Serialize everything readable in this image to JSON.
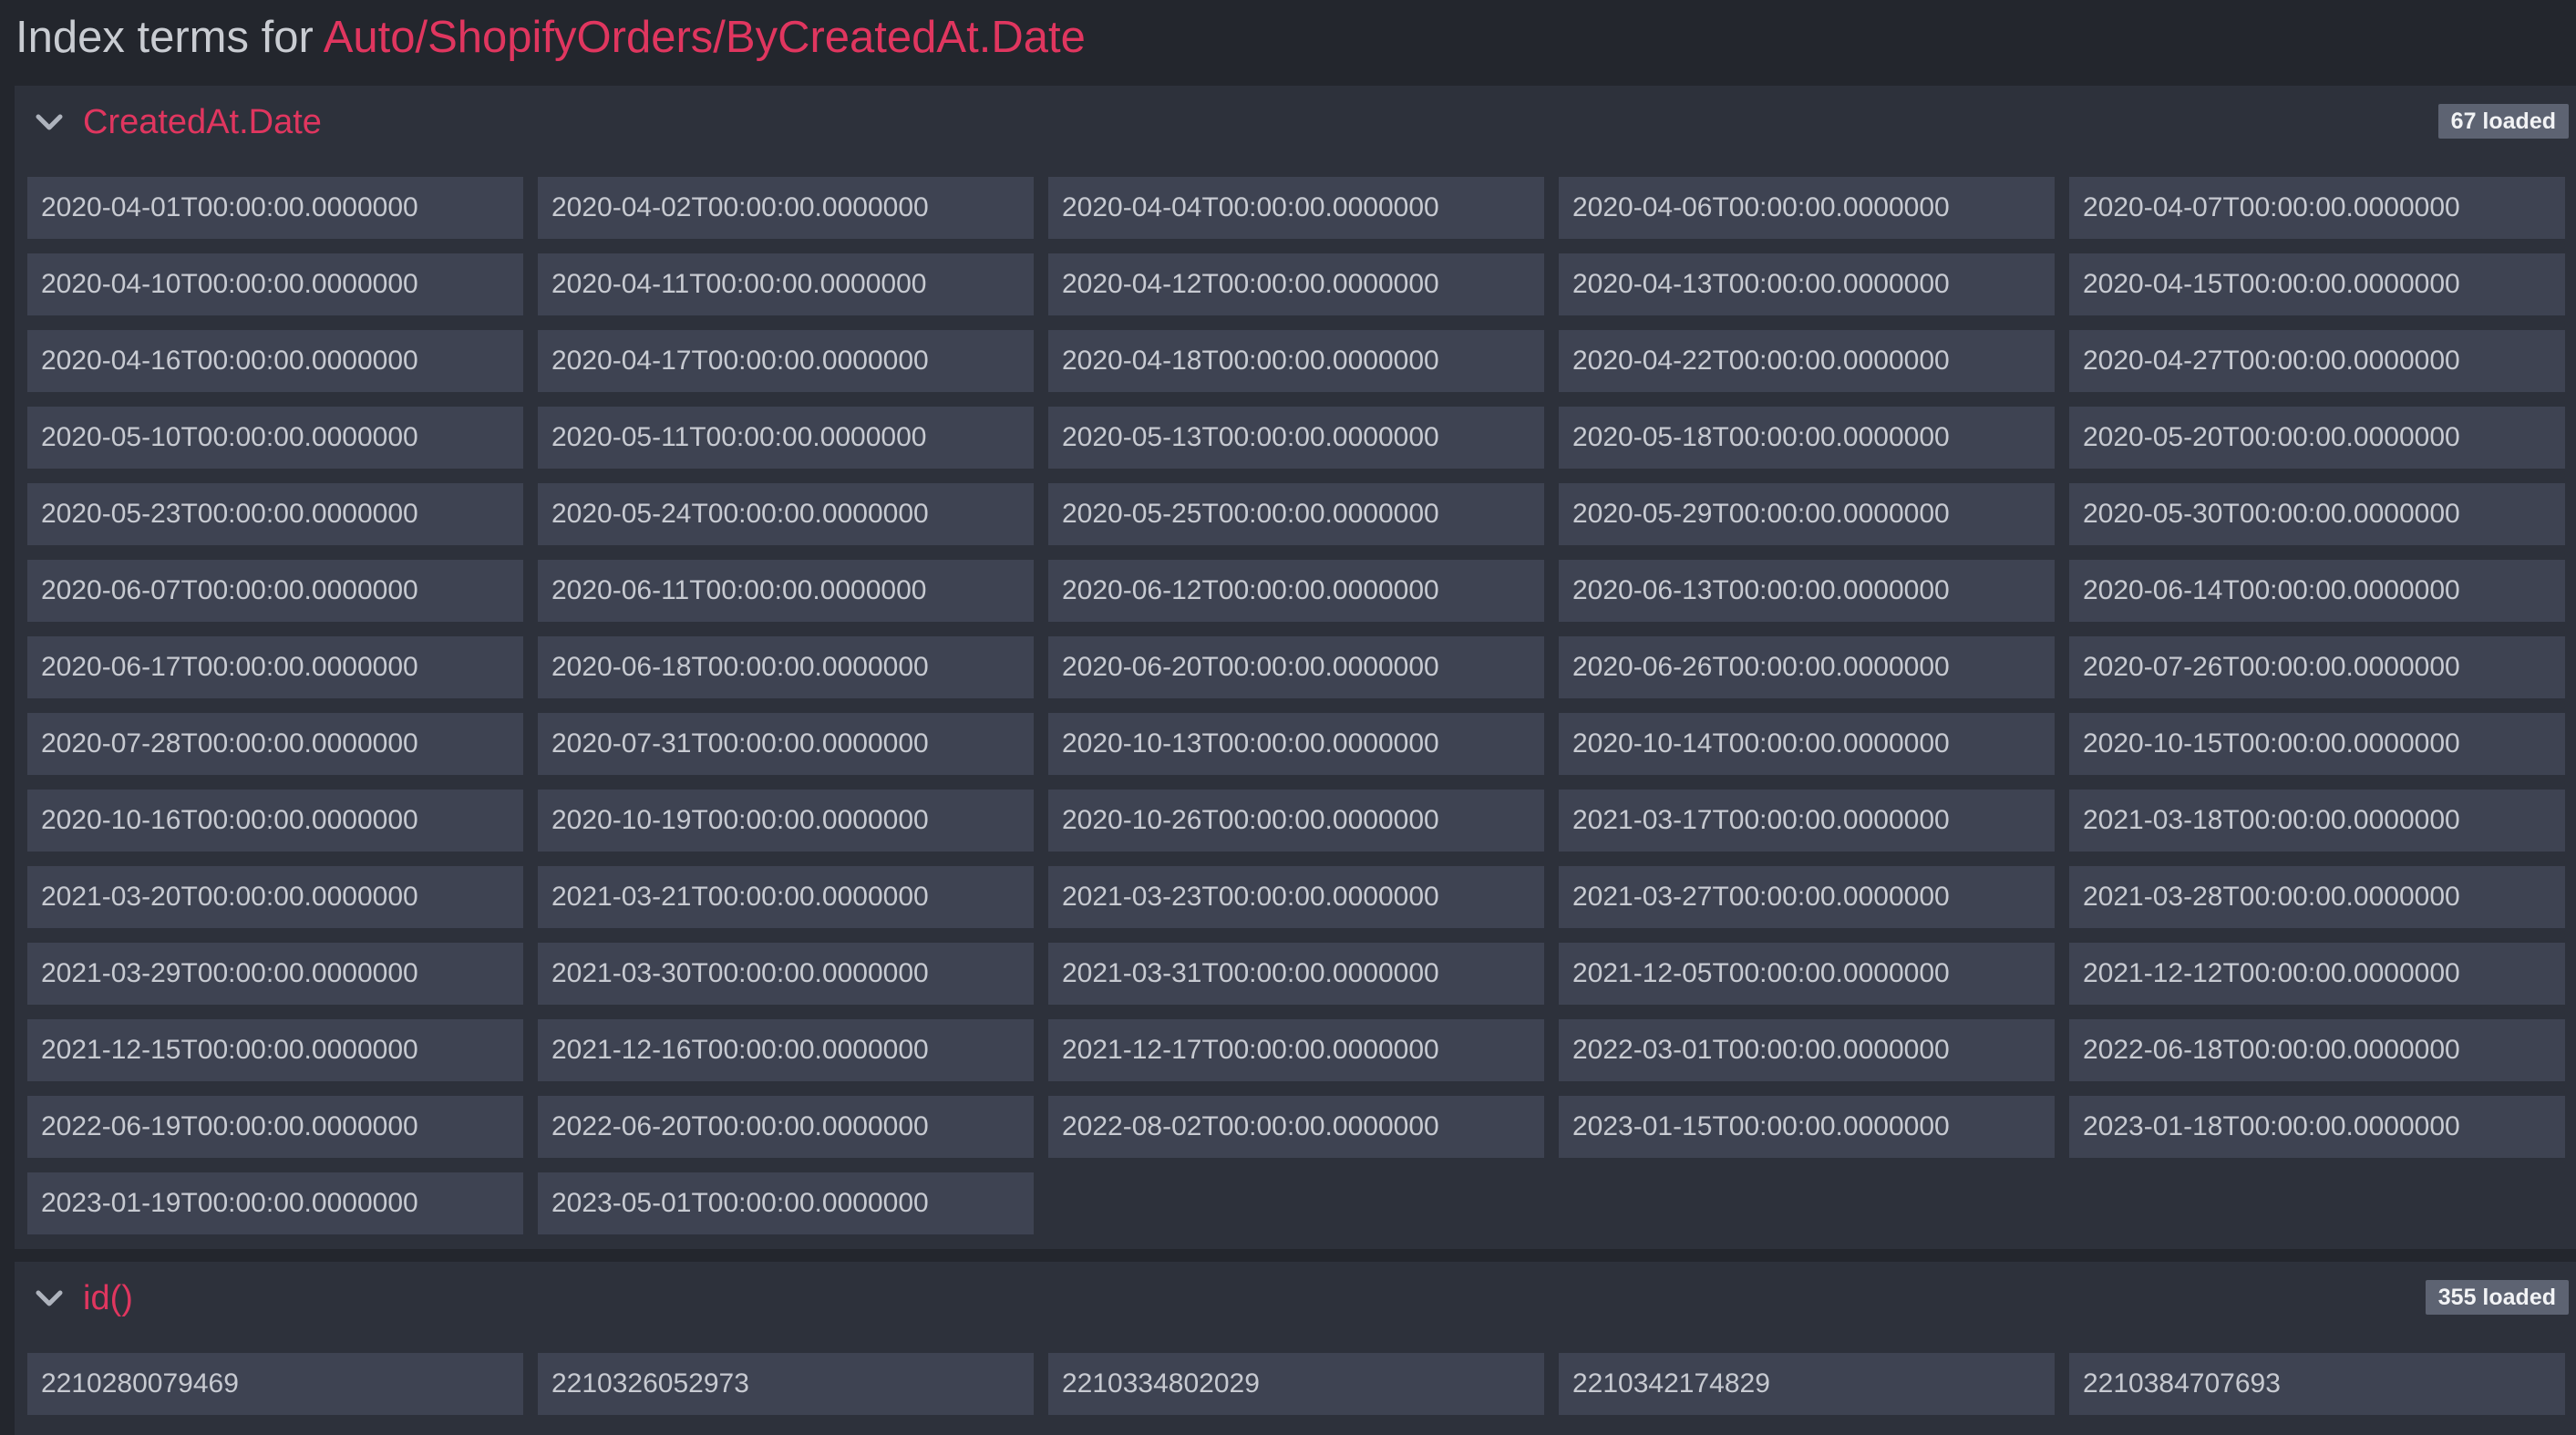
{
  "title": {
    "prefix": "Index terms for ",
    "path": "Auto/ShopifyOrders/ByCreatedAt.Date"
  },
  "icons": {
    "expand": "chevron-down-icon"
  },
  "colors": {
    "accent": "#e0365f",
    "background": "#23262d",
    "panel": "#2d313b",
    "term": "#3e4352",
    "badge": "#5d6372"
  },
  "sections": [
    {
      "field": "CreatedAt.Date",
      "loaded": "67 loaded",
      "terms": [
        "2020-04-01T00:00:00.0000000",
        "2020-04-02T00:00:00.0000000",
        "2020-04-04T00:00:00.0000000",
        "2020-04-06T00:00:00.0000000",
        "2020-04-07T00:00:00.0000000",
        "2020-04-10T00:00:00.0000000",
        "2020-04-11T00:00:00.0000000",
        "2020-04-12T00:00:00.0000000",
        "2020-04-13T00:00:00.0000000",
        "2020-04-15T00:00:00.0000000",
        "2020-04-16T00:00:00.0000000",
        "2020-04-17T00:00:00.0000000",
        "2020-04-18T00:00:00.0000000",
        "2020-04-22T00:00:00.0000000",
        "2020-04-27T00:00:00.0000000",
        "2020-05-10T00:00:00.0000000",
        "2020-05-11T00:00:00.0000000",
        "2020-05-13T00:00:00.0000000",
        "2020-05-18T00:00:00.0000000",
        "2020-05-20T00:00:00.0000000",
        "2020-05-23T00:00:00.0000000",
        "2020-05-24T00:00:00.0000000",
        "2020-05-25T00:00:00.0000000",
        "2020-05-29T00:00:00.0000000",
        "2020-05-30T00:00:00.0000000",
        "2020-06-07T00:00:00.0000000",
        "2020-06-11T00:00:00.0000000",
        "2020-06-12T00:00:00.0000000",
        "2020-06-13T00:00:00.0000000",
        "2020-06-14T00:00:00.0000000",
        "2020-06-17T00:00:00.0000000",
        "2020-06-18T00:00:00.0000000",
        "2020-06-20T00:00:00.0000000",
        "2020-06-26T00:00:00.0000000",
        "2020-07-26T00:00:00.0000000",
        "2020-07-28T00:00:00.0000000",
        "2020-07-31T00:00:00.0000000",
        "2020-10-13T00:00:00.0000000",
        "2020-10-14T00:00:00.0000000",
        "2020-10-15T00:00:00.0000000",
        "2020-10-16T00:00:00.0000000",
        "2020-10-19T00:00:00.0000000",
        "2020-10-26T00:00:00.0000000",
        "2021-03-17T00:00:00.0000000",
        "2021-03-18T00:00:00.0000000",
        "2021-03-20T00:00:00.0000000",
        "2021-03-21T00:00:00.0000000",
        "2021-03-23T00:00:00.0000000",
        "2021-03-27T00:00:00.0000000",
        "2021-03-28T00:00:00.0000000",
        "2021-03-29T00:00:00.0000000",
        "2021-03-30T00:00:00.0000000",
        "2021-03-31T00:00:00.0000000",
        "2021-12-05T00:00:00.0000000",
        "2021-12-12T00:00:00.0000000",
        "2021-12-15T00:00:00.0000000",
        "2021-12-16T00:00:00.0000000",
        "2021-12-17T00:00:00.0000000",
        "2022-03-01T00:00:00.0000000",
        "2022-06-18T00:00:00.0000000",
        "2022-06-19T00:00:00.0000000",
        "2022-06-20T00:00:00.0000000",
        "2022-08-02T00:00:00.0000000",
        "2023-01-15T00:00:00.0000000",
        "2023-01-18T00:00:00.0000000",
        "2023-01-19T00:00:00.0000000",
        "2023-05-01T00:00:00.0000000"
      ]
    },
    {
      "field": "id()",
      "loaded": "355 loaded",
      "terms": [
        "2210280079469",
        "2210326052973",
        "2210334802029",
        "2210342174829",
        "2210384707693"
      ]
    }
  ]
}
